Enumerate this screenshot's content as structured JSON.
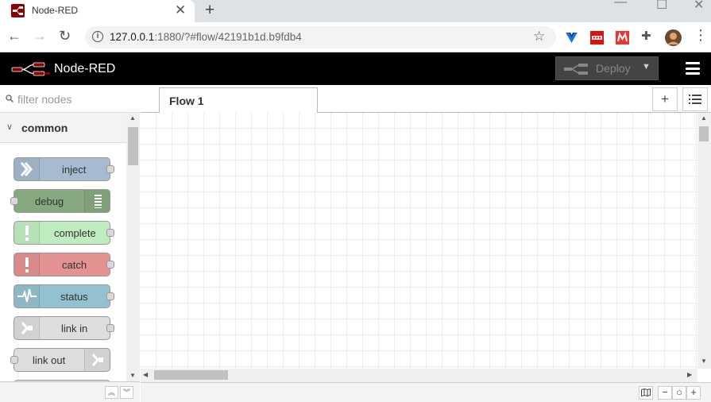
{
  "browser": {
    "tab_title": "Node-RED",
    "tab_close": "✕",
    "new_tab": "+",
    "url_host": "127.0.0.1",
    "url_rest": ":1880/?#flow/42191b1d.b9fdb4"
  },
  "app": {
    "title": "Node-RED",
    "deploy_label": "Deploy"
  },
  "palette": {
    "filter_placeholder": "filter nodes",
    "category": "common",
    "nodes": [
      {
        "label": "inject",
        "color": "#a6bbcf"
      },
      {
        "label": "debug",
        "color": "#87a980"
      },
      {
        "label": "complete",
        "color": "#c0edc0"
      },
      {
        "label": "catch",
        "color": "#e49191"
      },
      {
        "label": "status",
        "color": "#94c1d0"
      },
      {
        "label": "link in",
        "color": "#dddddd"
      },
      {
        "label": "link out",
        "color": "#dddddd"
      }
    ]
  },
  "workspace": {
    "tabs": [
      {
        "label": "Flow 1"
      }
    ],
    "add_tab": "+"
  },
  "colors": {
    "header_bg": "#000000",
    "logo_red": "#8f0000"
  }
}
